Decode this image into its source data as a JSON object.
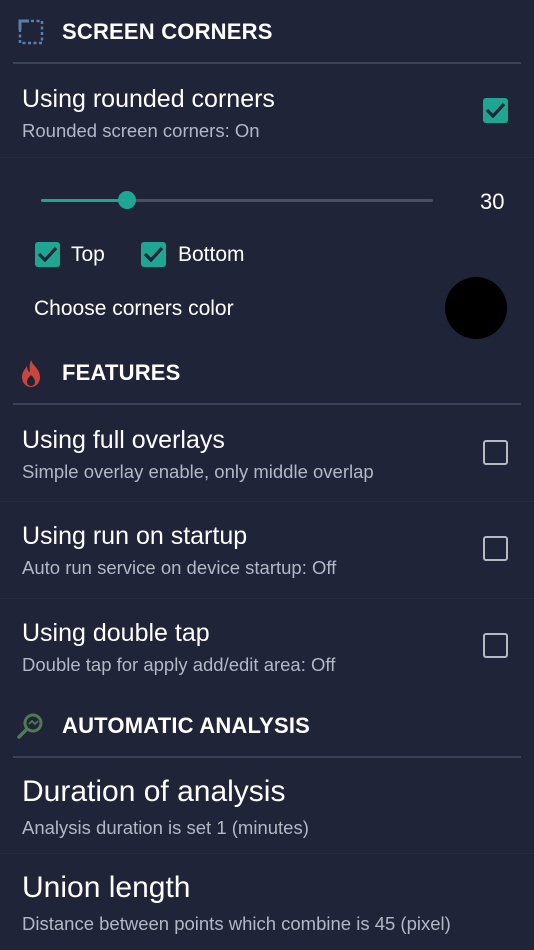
{
  "sections": {
    "screen_corners": {
      "title": "SCREEN CORNERS",
      "icon": "screen-corners-icon"
    },
    "features": {
      "title": "FEATURES",
      "icon": "flame-icon"
    },
    "automatic_analysis": {
      "title": "AUTOMATIC ANALYSIS",
      "icon": "magnify-icon"
    }
  },
  "rounded_corners": {
    "title": "Using rounded corners",
    "summary": "Rounded screen corners: On",
    "checked": true,
    "slider": {
      "value": "30",
      "fraction": 0.22
    },
    "top_label": "Top",
    "top_checked": true,
    "bottom_label": "Bottom",
    "bottom_checked": true,
    "color_label": "Choose corners color",
    "color_value": "#000000"
  },
  "features": {
    "full_overlays": {
      "title": "Using full overlays",
      "summary": "Simple overlay enable, only middle overlap",
      "checked": false
    },
    "run_on_startup": {
      "title": "Using run on startup",
      "summary": "Auto run service on device startup: Off",
      "checked": false
    },
    "double_tap": {
      "title": "Using double tap",
      "summary": "Double tap for apply add/edit area: Off",
      "checked": false
    }
  },
  "analysis": {
    "duration": {
      "title": "Duration of analysis",
      "summary": "Analysis duration is set 1 (minutes)"
    },
    "union_length": {
      "title": "Union length",
      "summary": "Distance between points which combine is 45 (pixel)"
    }
  },
  "colors": {
    "background": "#1f2438",
    "accent": "#1fa692",
    "flame": "#c8463e",
    "magnify": "#4f7a52",
    "corner_icon": "#5a7fa8"
  }
}
